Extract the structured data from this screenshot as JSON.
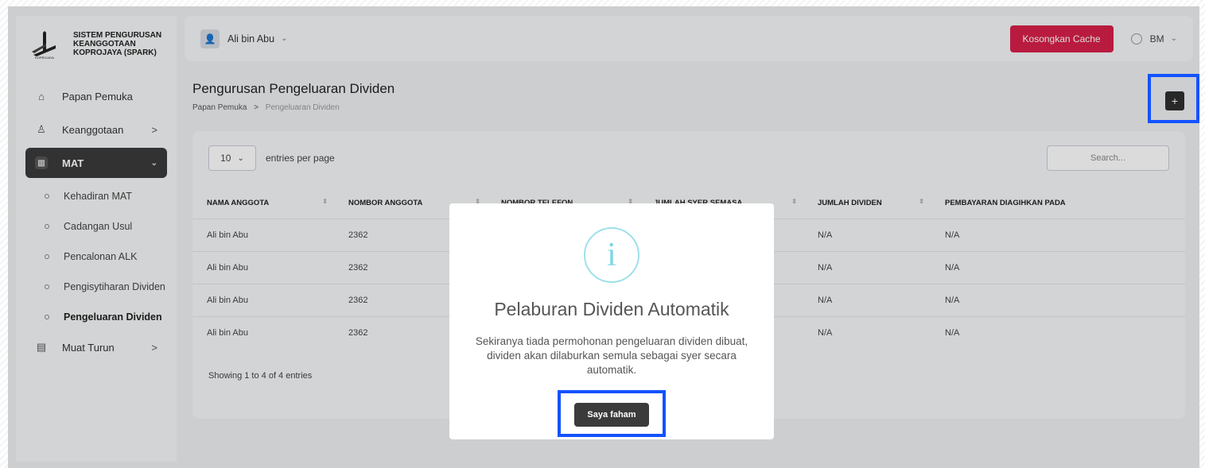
{
  "app": {
    "title": "SISTEM PENGURUSAN KEANGGOTAAN KOPROJAYA (SPARK)",
    "logo_caption": "KOPROJAYA"
  },
  "sidebar": {
    "items": [
      {
        "label": "Papan Pemuka",
        "icon": "home-icon"
      },
      {
        "label": "Keanggotaan",
        "icon": "user-icon",
        "chevron": ">"
      },
      {
        "label": "MAT",
        "icon": "map-icon",
        "chevron": "⌄",
        "active": true
      },
      {
        "label": "Muat Turun",
        "icon": "file-icon",
        "chevron": ">"
      }
    ],
    "mat_sub": [
      {
        "label": "Kehadiran MAT"
      },
      {
        "label": "Cadangan Usul"
      },
      {
        "label": "Pencalonan ALK"
      },
      {
        "label": "Pengisytiharan Dividen"
      },
      {
        "label": "Pengeluaran Dividen",
        "current": true
      }
    ]
  },
  "topbar": {
    "user_name": "Ali bin Abu",
    "cache_button": "Kosongkan Cache",
    "language": "BM",
    "accent_color": "#d8204a"
  },
  "page": {
    "title": "Pengurusan Pengeluaran Dividen",
    "breadcrumb": [
      "Papan Pemuka",
      "Pengeluaran Dividen"
    ],
    "add_button": "+"
  },
  "table": {
    "entries_value": "10",
    "entries_label": "entries per page",
    "search_placeholder": "Search...",
    "headers": [
      "NAMA ANGGOTA",
      "NOMBOR ANGGOTA",
      "NOMBOR TELEFON",
      "JUMLAH SYER SEMASA",
      "JUMLAH DIVIDEN",
      "PEMBAYARAN DIAGIHKAN PADA"
    ],
    "rows": [
      [
        "Ali bin Abu",
        "2362",
        "",
        "",
        "N/A",
        "N/A"
      ],
      [
        "Ali bin Abu",
        "2362",
        "",
        "",
        "N/A",
        "N/A"
      ],
      [
        "Ali bin Abu",
        "2362",
        "",
        "",
        "N/A",
        "N/A"
      ],
      [
        "Ali bin Abu",
        "2362",
        "",
        "",
        "N/A",
        "N/A"
      ]
    ],
    "showing": "Showing 1 to 4 of 4 entries"
  },
  "modal": {
    "icon": "info-icon",
    "icon_glyph": "i",
    "title": "Pelaburan Dividen Automatik",
    "text": "Sekiranya tiada permohonan pengeluaran dividen dibuat, dividen akan dilaburkan semula sebagai syer secara automatik.",
    "confirm_button": "Saya faham"
  }
}
